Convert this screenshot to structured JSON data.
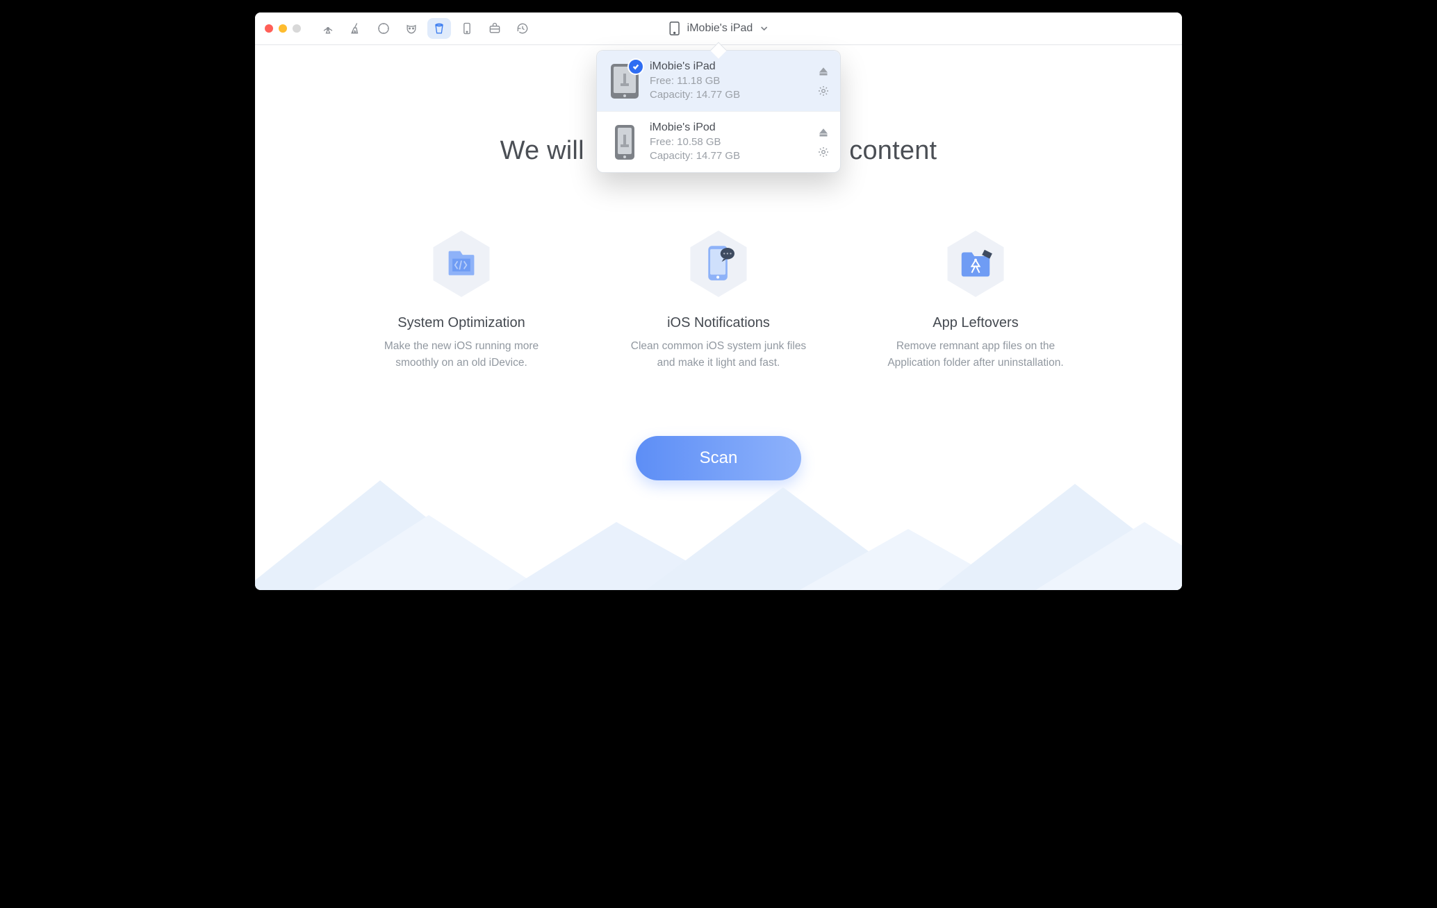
{
  "toolbar": {
    "selected_device": "iMobie's iPad"
  },
  "headline": {
    "prefix": "We will",
    "suffix": "content"
  },
  "dropdown": {
    "devices": [
      {
        "name": "iMobie's iPad",
        "free_label": "Free: 11.18 GB",
        "capacity_label": "Capacity: 14.77 GB",
        "checked": true
      },
      {
        "name": "iMobie's iPod",
        "free_label": "Free: 10.58 GB",
        "capacity_label": "Capacity: 14.77 GB",
        "checked": false
      }
    ]
  },
  "cards": [
    {
      "title": "System Optimization",
      "desc": "Make the new iOS running more smoothly on an old iDevice."
    },
    {
      "title": "iOS Notifications",
      "desc": "Clean common iOS system junk files and make it light and fast."
    },
    {
      "title": "App Leftovers",
      "desc": "Remove remnant app files on the Application folder after uninstallation."
    }
  ],
  "scan_label": "Scan"
}
